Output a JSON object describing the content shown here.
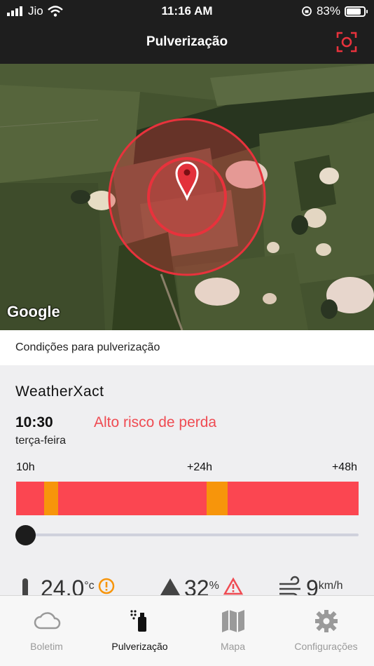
{
  "status_bar": {
    "carrier": "Jio",
    "time": "11:16 AM",
    "battery": "83%",
    "battery_level": 0.83
  },
  "header": {
    "title": "Pulverização",
    "action_icon": "locate-target-icon"
  },
  "map": {
    "attribution": "Google",
    "marker_icon": "map-pin-icon",
    "accent_color": "#e8323c"
  },
  "section": {
    "title": "Condições para pulverização"
  },
  "forecast": {
    "provider": "WeatherXact",
    "time": "10:30",
    "weekday": "terça-feira",
    "risk_label": "Alto risco de perda",
    "risk_color": "#ef4b52"
  },
  "timeline": {
    "labels": [
      "10h",
      "+24h",
      "+48h"
    ],
    "range_hours": [
      0,
      48
    ],
    "high_risk_color": "#fb4651",
    "moderate_risk_color": "#f7950b",
    "moderate_windows": [
      {
        "start_h": 3.9,
        "end_h": 5.9
      },
      {
        "start_h": 26.7,
        "end_h": 29.6
      }
    ],
    "slider_position_h": 0
  },
  "metrics": {
    "temperature": {
      "value": "24,0",
      "unit": "°c",
      "icon": "thermometer-icon",
      "alert_icon": "warning-circle-icon"
    },
    "humidity": {
      "value": "32",
      "unit": "%",
      "icon": "humidity-drop-icon",
      "alert_icon": "warning-triangle-icon"
    },
    "wind": {
      "value": "9",
      "unit": "km/h",
      "icon": "wind-icon"
    }
  },
  "tabs": [
    {
      "label": "Boletim",
      "icon": "cloud-icon",
      "active": false
    },
    {
      "label": "Pulverização",
      "icon": "sprayer-icon",
      "active": true
    },
    {
      "label": "Mapa",
      "icon": "map-icon",
      "active": false
    },
    {
      "label": "Configurações",
      "icon": "gear-icon",
      "active": false
    }
  ]
}
